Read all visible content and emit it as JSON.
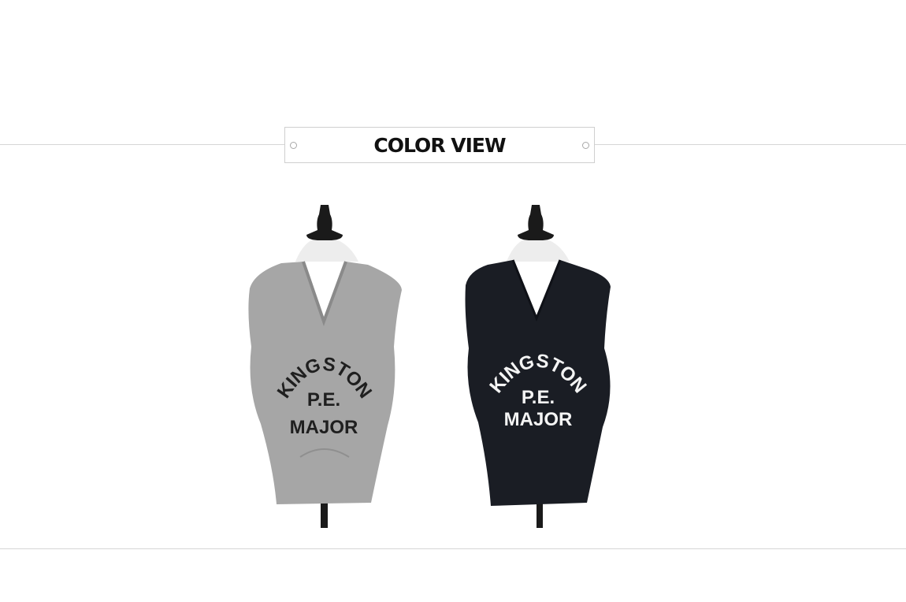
{
  "section": {
    "title": "COLOR VIEW"
  },
  "products": [
    {
      "color_name": "gray",
      "body_color": "#a6a6a6",
      "print_color": "#1f1f1f",
      "print_lines": [
        "KINGSTON",
        "P.E.",
        "MAJOR"
      ]
    },
    {
      "color_name": "black",
      "body_color": "#1a1d24",
      "print_color": "#f4f4f4",
      "print_lines": [
        "KINGSTON",
        "P.E.",
        "MAJOR"
      ]
    }
  ],
  "colors": {
    "mannequin": "#ededed",
    "stand": "#1a1a1a",
    "divider": "#d6d6d6"
  }
}
